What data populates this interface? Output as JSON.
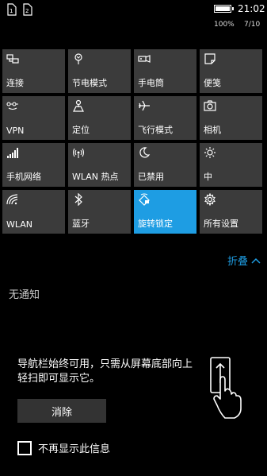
{
  "status": {
    "time": "21:02",
    "battery_pct": "100%",
    "date": "7/10",
    "battery_level": 1.0
  },
  "tiles": [
    {
      "label": "连接",
      "icon": "connect-icon",
      "active": false
    },
    {
      "label": "节电模式",
      "icon": "battery-saver-icon",
      "active": false
    },
    {
      "label": "手电筒",
      "icon": "flashlight-icon",
      "active": false
    },
    {
      "label": "便笺",
      "icon": "note-icon",
      "active": false
    },
    {
      "label": "VPN",
      "icon": "vpn-icon",
      "active": false
    },
    {
      "label": "定位",
      "icon": "location-icon",
      "active": false
    },
    {
      "label": "飞行模式",
      "icon": "airplane-icon",
      "active": false
    },
    {
      "label": "相机",
      "icon": "camera-icon",
      "active": false
    },
    {
      "label": "手机网络",
      "icon": "cellular-icon",
      "active": false
    },
    {
      "label": "WLAN 热点",
      "icon": "hotspot-icon",
      "active": false
    },
    {
      "label": "已禁用",
      "icon": "moon-icon",
      "active": false
    },
    {
      "label": "中",
      "icon": "brightness-icon",
      "active": false
    },
    {
      "label": "WLAN",
      "icon": "wifi-icon",
      "active": false
    },
    {
      "label": "蓝牙",
      "icon": "bluetooth-icon",
      "active": false
    },
    {
      "label": "旋转锁定",
      "icon": "rotation-lock-icon",
      "active": true
    },
    {
      "label": "所有设置",
      "icon": "settings-icon",
      "active": false
    }
  ],
  "collapse_label": "折叠",
  "no_notifications": "无通知",
  "hint": {
    "text": "导航栏始终可用，只需从屏幕底部向上轻扫即可显示它。",
    "dismiss_label": "消除",
    "checkbox_label": "不再显示此信息",
    "checkbox_checked": false
  },
  "colors": {
    "accent": "#1e9de3",
    "tile": "#3b3b3b",
    "background": "#000000"
  }
}
